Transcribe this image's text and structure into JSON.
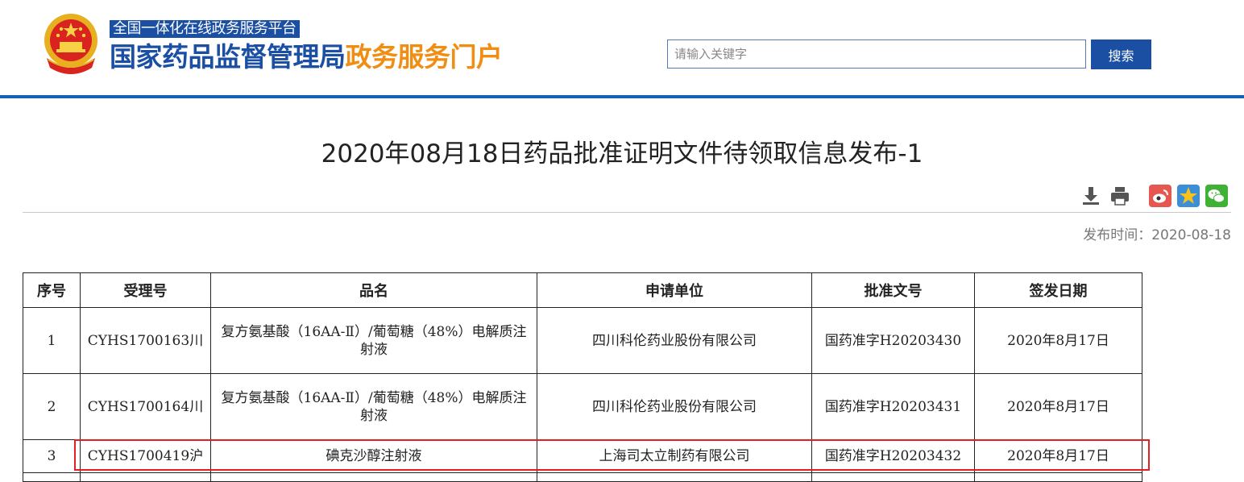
{
  "header": {
    "platform_badge": "全国一体化在线政务服务平台",
    "title_main": "国家药品监督管理局",
    "title_accent": "政务服务门户",
    "emblem_icon": "national-emblem-icon",
    "colors": {
      "brand_blue": "#1a4fa3",
      "accent_orange": "#ef8e12",
      "header_line": "#1560b8"
    }
  },
  "search": {
    "placeholder": "请输入关键字",
    "value": "",
    "button_label": "搜索"
  },
  "article": {
    "title": "2020年08月18日药品批准证明文件待领取信息发布-1",
    "publish_label": "发布时间：",
    "publish_date": "2020-08-18",
    "tools": [
      "download-icon",
      "print-icon"
    ],
    "share": [
      "weibo-icon",
      "qzone-icon",
      "wechat-icon"
    ]
  },
  "table": {
    "headers": [
      "序号",
      "受理号",
      "品名",
      "申请单位",
      "批准文号",
      "签发日期"
    ],
    "rows": [
      [
        "1",
        "CYHS1700163川",
        "复方氨基酸（16AA-Ⅱ）/葡萄糖（48%）电解质注射液",
        "四川科伦药业股份有限公司",
        "国药准字H20203430",
        "2020年8月17日"
      ],
      [
        "2",
        "CYHS1700164川",
        "复方氨基酸（16AA-Ⅱ）/葡萄糖（48%）电解质注射液",
        "四川科伦药业股份有限公司",
        "国药准字H20203431",
        "2020年8月17日"
      ],
      [
        "3",
        "CYHS1700419沪",
        "碘克沙醇注射液",
        "上海司太立制药有限公司",
        "国药准字H20203432",
        "2020年8月17日"
      ]
    ],
    "highlighted_row": 3,
    "highlight_color": "#e31e24"
  }
}
